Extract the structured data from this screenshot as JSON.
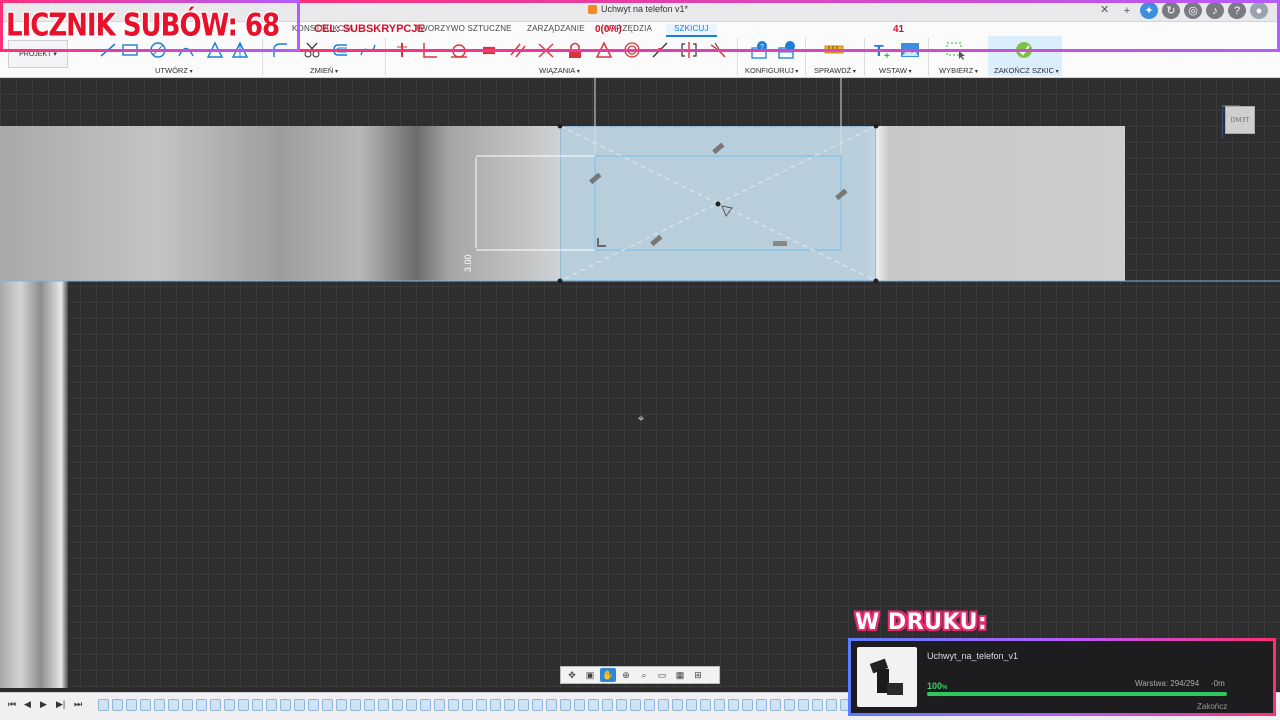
{
  "window": {
    "document_title": "Uchwyt na telefon v1*",
    "tabs": [
      {
        "label": "KONSTRUKCJA"
      },
      {
        "label": "TWORZYWO SZTUCZNE"
      },
      {
        "label": "ZARZĄDZANIE"
      },
      {
        "label": "NARZĘDZIA"
      },
      {
        "label": "SZKICUJ",
        "active": true
      }
    ],
    "project_label": "PROJEKT"
  },
  "ribbon": {
    "groups": [
      {
        "label": "UTWÓRZ"
      },
      {
        "label": "ZMIEŃ"
      },
      {
        "label": "WIĄZANIA"
      },
      {
        "label": "KONFIGURUJ"
      },
      {
        "label": "SPRAWDŹ"
      },
      {
        "label": "WSTAW"
      },
      {
        "label": "WYBIERZ"
      },
      {
        "label": "ZAKOŃCZ SZKIC"
      }
    ],
    "accent": "#1a7fd6",
    "constraint_color": "#d9343a"
  },
  "viewport": {
    "dimension_value": "3.00",
    "viewcube_label": "DM3T"
  },
  "nav_toolbar": {
    "icons": [
      "orbit-icon",
      "look-at-icon",
      "pan-icon",
      "zoom-icon",
      "zoom-window-icon",
      "display-icon",
      "grid-icon",
      "viewports-icon"
    ],
    "active": "pan-icon"
  },
  "overlay": {
    "subs_counter": "LICZNIK SUBÓW: 68",
    "goal_label": "CEL: SUBSKRYPCJE",
    "goal_percent": "0(0%)",
    "goal_count": "41",
    "print_title": "W DRUKU:",
    "print": {
      "file_name": "Uchwyt_na_telefon_v1",
      "progress_percent": "100",
      "progress_unit": "%",
      "layer_text": "Warstwa: 294/294",
      "time_left": "-0m",
      "finish_label": "Zakończ",
      "progress_fraction": 1.0
    }
  }
}
